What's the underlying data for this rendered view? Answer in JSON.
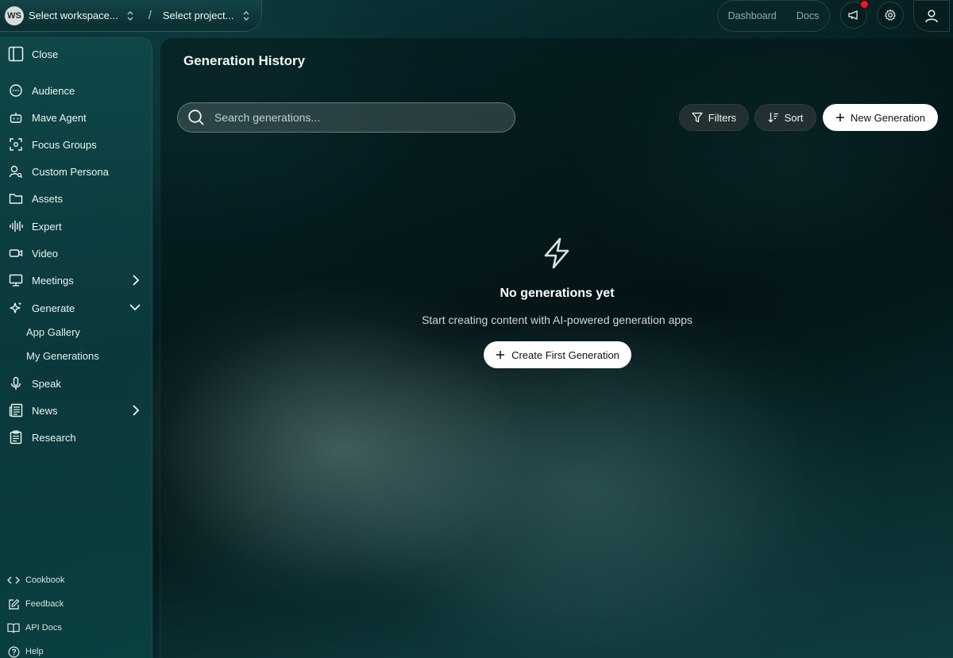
{
  "topbar": {
    "workspace_initials": "WS",
    "workspace_label": "Select workspace...",
    "separator": "/",
    "project_label": "Select project...",
    "nav": {
      "dashboard": "Dashboard",
      "docs": "Docs"
    },
    "icons": [
      "megaphone-icon",
      "gear-icon",
      "user-icon"
    ],
    "notification_color": "#e11d2a"
  },
  "sidebar": {
    "close_label": "Close",
    "items": [
      {
        "label": "Audience",
        "icon": "chat-bubble-icon"
      },
      {
        "label": "Mave Agent",
        "icon": "robot-icon"
      },
      {
        "label": "Focus Groups",
        "icon": "focus-icon"
      },
      {
        "label": "Custom Persona",
        "icon": "person-search-icon"
      },
      {
        "label": "Assets",
        "icon": "folder-icon"
      },
      {
        "label": "Expert",
        "icon": "waveform-icon"
      },
      {
        "label": "Video",
        "icon": "video-icon"
      },
      {
        "label": "Meetings",
        "icon": "presentation-icon",
        "expand": "chevron-right"
      },
      {
        "label": "Generate",
        "icon": "sparkles-icon",
        "expand": "chevron-down"
      },
      {
        "label": "Speak",
        "icon": "microphone-icon"
      },
      {
        "label": "News",
        "icon": "newspaper-icon",
        "expand": "chevron-right"
      },
      {
        "label": "Research",
        "icon": "clipboard-icon"
      }
    ],
    "generate_sub": [
      "App Gallery",
      "My Generations"
    ],
    "footer": [
      {
        "label": "Cookbook",
        "icon": "code-icon"
      },
      {
        "label": "Feedback",
        "icon": "edit-icon"
      },
      {
        "label": "API Docs",
        "icon": "book-icon"
      },
      {
        "label": "Help",
        "icon": "help-circle-icon"
      }
    ]
  },
  "main": {
    "title": "Generation History",
    "search_placeholder": "Search generations...",
    "filters_label": "Filters",
    "sort_label": "Sort",
    "new_generation_label": "New Generation",
    "empty_icon": "lightning-icon",
    "empty_title": "No generations yet",
    "empty_subtitle": "Start creating content with AI-powered generation apps",
    "create_first_label": "Create First Generation"
  }
}
